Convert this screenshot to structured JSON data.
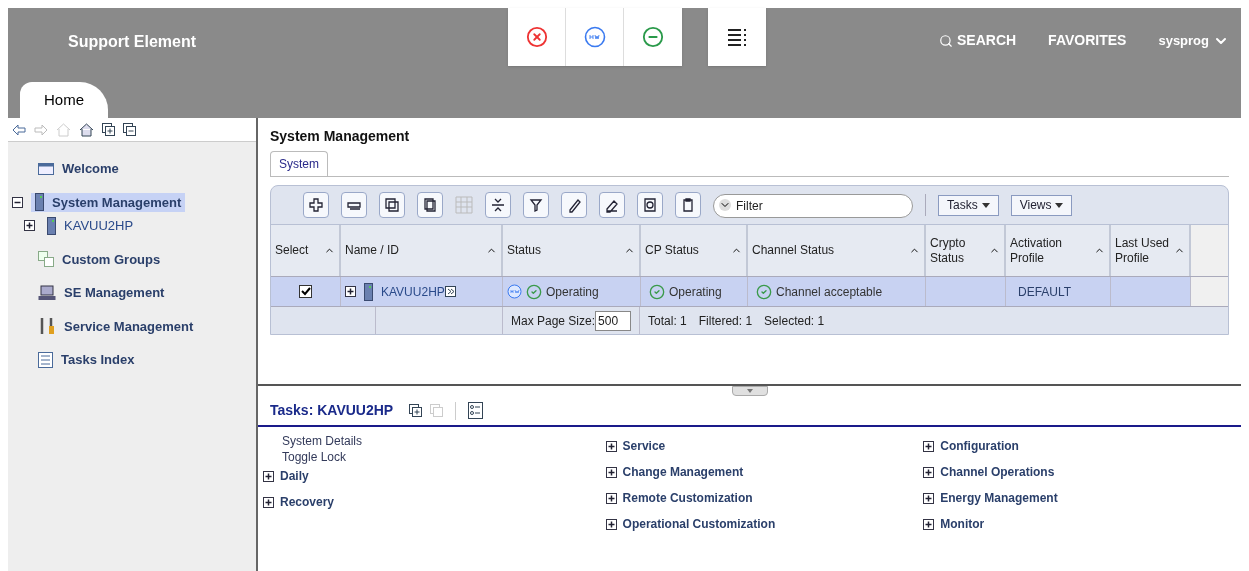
{
  "header": {
    "title": "Support Element",
    "search": "SEARCH",
    "favorites": "FAVORITES",
    "user": "sysprog"
  },
  "tabs": [
    {
      "label": "Home",
      "selected": true
    }
  ],
  "sidebar": {
    "items": [
      {
        "label": "Welcome"
      },
      {
        "label": "System Management",
        "selected": true,
        "expanded": true,
        "children": [
          {
            "label": "KAVUU2HP",
            "selected": false,
            "expanded": false
          }
        ]
      },
      {
        "label": "Custom Groups"
      },
      {
        "label": "SE Management"
      },
      {
        "label": "Service Management"
      },
      {
        "label": "Tasks Index"
      }
    ]
  },
  "main": {
    "title": "System Management",
    "tabs": [
      {
        "label": "System",
        "selected": true
      }
    ],
    "filter": {
      "placeholder": "Filter"
    },
    "menus": [
      "Tasks",
      "Views"
    ],
    "columns": [
      "Select",
      "Name / ID",
      "Status",
      "CP Status",
      "Channel Status",
      "Crypto Status",
      "Activation Profile",
      "Last Used Profile"
    ],
    "rows": [
      {
        "checked": true,
        "selected": true,
        "name": "KAVUU2HP",
        "status": "Operating",
        "cp_status": "Operating",
        "channel_status": "Channel acceptable",
        "activation_profile": "DEFAULT"
      }
    ],
    "footer": {
      "page_size_label": "Max Page Size:",
      "page_size": "500",
      "total": "Total: 1",
      "filtered": "Filtered: 1",
      "selected": "Selected: 1"
    }
  },
  "tasks": {
    "title": "Tasks: KAVUU2HP",
    "columns": [
      [
        {
          "label": "System Details",
          "kind": "task"
        },
        {
          "label": "Toggle Lock",
          "kind": "task"
        },
        {
          "label": "Daily",
          "kind": "group"
        },
        {
          "label": "Recovery",
          "kind": "group"
        }
      ],
      [
        {
          "label": "Service",
          "kind": "group"
        },
        {
          "label": "Change Management",
          "kind": "group"
        },
        {
          "label": "Remote Customization",
          "kind": "group"
        },
        {
          "label": "Operational Customization",
          "kind": "group"
        }
      ],
      [
        {
          "label": "Configuration",
          "kind": "group"
        },
        {
          "label": "Channel Operations",
          "kind": "group"
        },
        {
          "label": "Energy Management",
          "kind": "group"
        },
        {
          "label": "Monitor",
          "kind": "group"
        }
      ]
    ]
  }
}
